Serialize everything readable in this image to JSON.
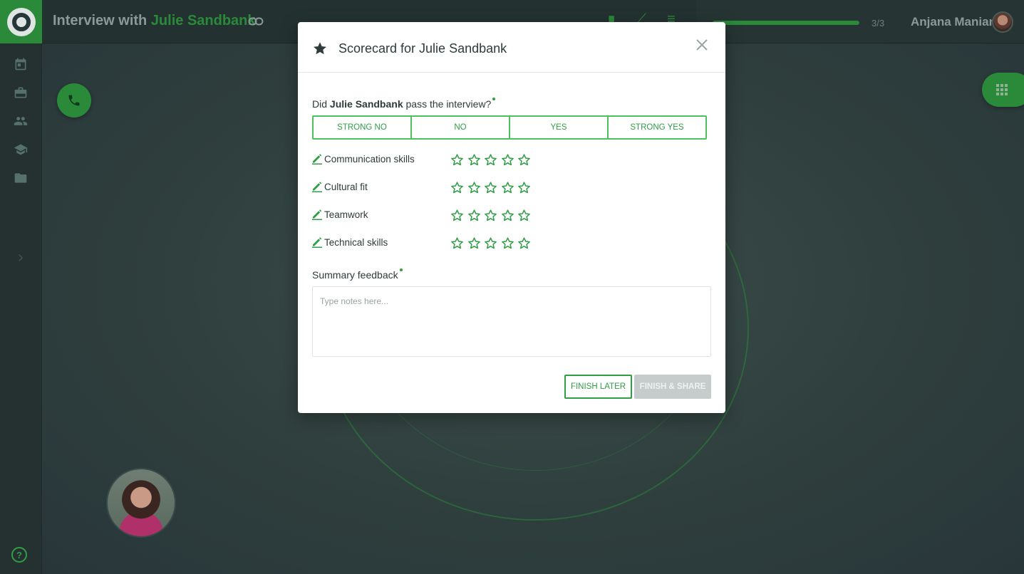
{
  "header": {
    "title_prefix": "Interview with",
    "candidate_name": "Julie Sandbank",
    "progress_count": "3/3",
    "progress_fraction": 1.0,
    "user_name": "Anjana Manian"
  },
  "sidebar": {
    "items": [
      {
        "icon": "calendar-icon"
      },
      {
        "icon": "briefcase-icon"
      },
      {
        "icon": "people-icon"
      },
      {
        "icon": "graduation-cap-icon"
      },
      {
        "icon": "folder-icon"
      },
      {
        "icon": "chevron-right-icon"
      }
    ],
    "help_label": "?"
  },
  "modal": {
    "title": "Scorecard for Julie Sandbank",
    "question_prefix": "Did ",
    "question_name": "Julie Sandbank",
    "question_suffix": " pass the interview?",
    "decision_options": [
      "STRONG NO",
      "NO",
      "YES",
      "STRONG YES"
    ],
    "criteria": [
      {
        "label": "Communication skills",
        "rating": 0,
        "max": 5
      },
      {
        "label": "Cultural fit",
        "rating": 0,
        "max": 5
      },
      {
        "label": "Teamwork",
        "rating": 0,
        "max": 5
      },
      {
        "label": "Technical skills",
        "rating": 0,
        "max": 5
      }
    ],
    "summary_label": "Summary feedback",
    "summary_placeholder": "Type notes here...",
    "summary_value": "",
    "finish_later_label": "FINISH LATER",
    "finish_share_label": "FINISH & SHARE"
  },
  "colors": {
    "accent": "#2f9e44",
    "brand": "#2a8a3a",
    "text": "#2d3b3a",
    "disabled": "#c6cccb"
  }
}
